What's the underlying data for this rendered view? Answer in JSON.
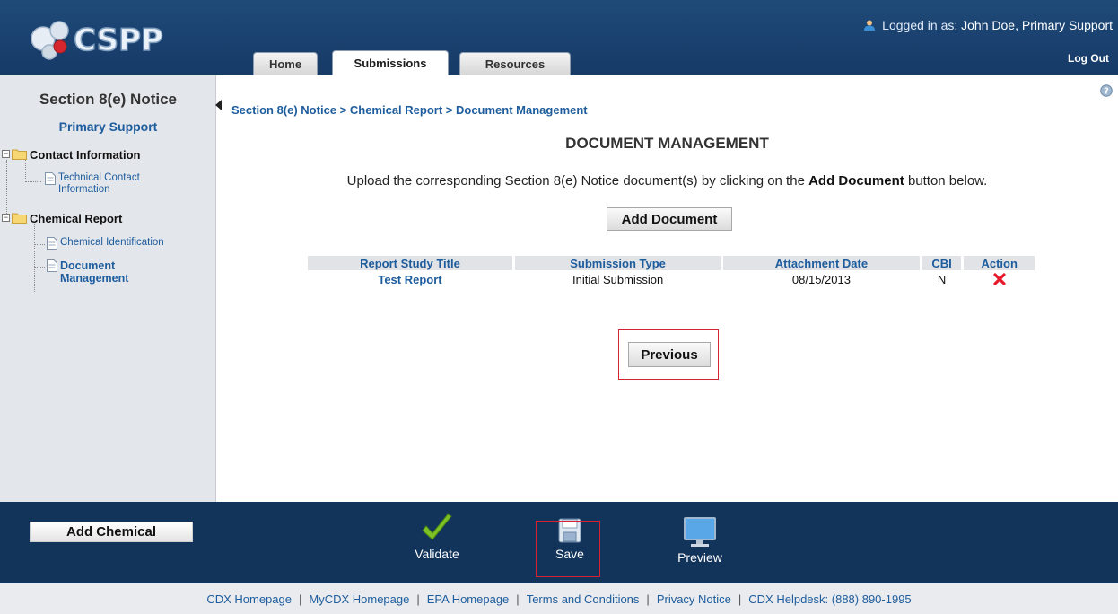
{
  "header": {
    "logo_text": "CSPP",
    "login_prefix": "Logged in as:",
    "login_user": "John Doe, Primary Support",
    "logout_label": "Log Out",
    "tabs": [
      {
        "label": "Home"
      },
      {
        "label": "Submissions",
        "active": true
      },
      {
        "label": "Resources"
      }
    ]
  },
  "sidebar": {
    "title": "Section 8(e) Notice",
    "role": "Primary Support",
    "tree": {
      "contact_folder": "Contact Information",
      "technical_contact_line1": "Technical Contact",
      "technical_contact_line2": "Information",
      "chemical_folder": "Chemical Report",
      "chemical_identification": "Chemical Identification",
      "document_mgmt_line1": "Document",
      "document_mgmt_line2": "Management"
    }
  },
  "main": {
    "breadcrumb": [
      "Section 8(e) Notice",
      "Chemical Report",
      "Document Management"
    ],
    "breadcrumb_sep": " > ",
    "title": "DOCUMENT MANAGEMENT",
    "instructions_pre": "Upload the corresponding Section 8(e) Notice document(s) by clicking on the",
    "instructions_bold": "Add Document",
    "instructions_post": "button below.",
    "add_document_label": "Add Document",
    "table": {
      "headers": [
        "Report Study Title",
        "Submission Type",
        "Attachment Date",
        "CBI",
        "Action"
      ],
      "rows": [
        {
          "title": "Test Report",
          "type": "Initial Submission",
          "date": "08/15/2013",
          "cbi": "N",
          "action": "delete-icon"
        }
      ]
    },
    "previous_label": "Previous"
  },
  "footer": {
    "add_chemical_label": "Add Chemical",
    "tools": [
      {
        "label": "Validate",
        "icon": "check-icon"
      },
      {
        "label": "Save",
        "icon": "save-icon"
      },
      {
        "label": "Preview",
        "icon": "monitor-icon"
      }
    ],
    "links": [
      "CDX Homepage",
      "MyCDX Homepage",
      "EPA Homepage",
      "Terms and Conditions",
      "Privacy Notice"
    ],
    "helpdesk": "CDX Helpdesk: (888) 890-1995",
    "separator": "|"
  },
  "colors": {
    "header_bg": "#1a4170",
    "link_blue": "#1d5c9d",
    "footer_bg": "#12335a",
    "highlight_red": "#d62333",
    "delete_red": "#e8192c"
  }
}
